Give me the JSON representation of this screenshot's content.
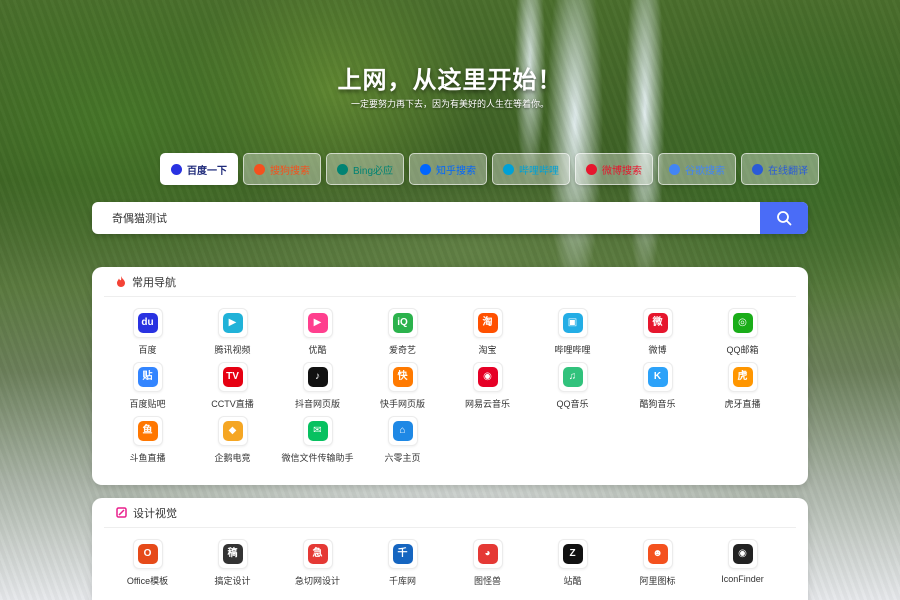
{
  "hero": {
    "title": "上网，从这里开始！",
    "subtitle": "一定要努力再下去，因为有美好的人生在等着你。"
  },
  "engines": [
    {
      "label": "百度一下",
      "icon": "baidu-icon",
      "color": "#2932e1",
      "active": true
    },
    {
      "label": "搜狗搜索",
      "icon": "sogou-icon",
      "color": "#f4511e",
      "active": false
    },
    {
      "label": "Bing必应",
      "icon": "bing-icon",
      "color": "#008373",
      "active": false
    },
    {
      "label": "知乎搜索",
      "icon": "zhihu-icon",
      "color": "#0066ff",
      "active": false
    },
    {
      "label": "哔哩哔哩",
      "icon": "bilibili-icon",
      "color": "#00a1d6",
      "active": false
    },
    {
      "label": "微博搜索",
      "icon": "weibo-icon",
      "color": "#e6162d",
      "active": false
    },
    {
      "label": "谷歌搜索",
      "icon": "google-icon",
      "color": "#4285f4",
      "active": false
    },
    {
      "label": "在线翻译",
      "icon": "translate-icon",
      "color": "#2a5bd7",
      "active": false
    }
  ],
  "search": {
    "value": "奇偶猫测试",
    "button_icon": "search-icon",
    "button_color": "#4a6cf7"
  },
  "sections": [
    {
      "title": "常用导航",
      "icon": "fire-icon",
      "icon_color": "#f44336",
      "items": [
        {
          "label": "百度",
          "icon": "baidu-icon",
          "glyph": "du",
          "color": "#2932e1"
        },
        {
          "label": "腾讯视频",
          "icon": "tencent-video-icon",
          "glyph": "▶",
          "color": "#20b2d8"
        },
        {
          "label": "优酷",
          "icon": "youku-icon",
          "glyph": "▶",
          "color": "#ff3f8e"
        },
        {
          "label": "爱奇艺",
          "icon": "iqiyi-icon",
          "glyph": "iQ",
          "color": "#2bb24c"
        },
        {
          "label": "淘宝",
          "icon": "taobao-icon",
          "glyph": "淘",
          "color": "#ff5000"
        },
        {
          "label": "哔哩哔哩",
          "icon": "bilibili-icon",
          "glyph": "▣",
          "color": "#23ade5"
        },
        {
          "label": "微博",
          "icon": "weibo-icon",
          "glyph": "微",
          "color": "#e6162d"
        },
        {
          "label": "QQ邮箱",
          "icon": "qq-mail-icon",
          "glyph": "◎",
          "color": "#1aad19"
        },
        {
          "label": "百度贴吧",
          "icon": "tieba-icon",
          "glyph": "贴",
          "color": "#3385ff"
        },
        {
          "label": "CCTV直播",
          "icon": "cctv-icon",
          "glyph": "TV",
          "color": "#e60012"
        },
        {
          "label": "抖音网页版",
          "icon": "douyin-icon",
          "glyph": "♪",
          "color": "#111111"
        },
        {
          "label": "快手网页版",
          "icon": "kuaishou-icon",
          "glyph": "快",
          "color": "#ff7a00"
        },
        {
          "label": "网易云音乐",
          "icon": "netease-music-icon",
          "glyph": "◉",
          "color": "#e60026"
        },
        {
          "label": "QQ音乐",
          "icon": "qq-music-icon",
          "glyph": "♫",
          "color": "#31c27c"
        },
        {
          "label": "酷狗音乐",
          "icon": "kugou-icon",
          "glyph": "K",
          "color": "#2ca2f9"
        },
        {
          "label": "虎牙直播",
          "icon": "huya-icon",
          "glyph": "虎",
          "color": "#ff9600"
        },
        {
          "label": "斗鱼直播",
          "icon": "douyu-icon",
          "glyph": "鱼",
          "color": "#ff7700"
        },
        {
          "label": "企鹅电竞",
          "icon": "penguin-esports-icon",
          "glyph": "◆",
          "color": "#f5a623"
        },
        {
          "label": "微信文件传输助手",
          "icon": "wechat-icon",
          "glyph": "✉",
          "color": "#07c160"
        },
        {
          "label": "六零主页",
          "icon": "home-icon",
          "glyph": "⌂",
          "color": "#1e88e5"
        }
      ]
    },
    {
      "title": "设计视觉",
      "icon": "design-icon",
      "icon_color": "#e91e8c",
      "items": [
        {
          "label": "Office模板",
          "icon": "office-icon",
          "glyph": "O",
          "color": "#e64a19"
        },
        {
          "label": "搞定设计",
          "icon": "gaoding-icon",
          "glyph": "稿",
          "color": "#333333"
        },
        {
          "label": "急切网设计",
          "icon": "jiqie-icon",
          "glyph": "急",
          "color": "#e53935"
        },
        {
          "label": "千库网",
          "icon": "qianku-icon",
          "glyph": "千",
          "color": "#1565c0"
        },
        {
          "label": "图怪兽",
          "icon": "tuguaishou-icon",
          "glyph": "◕",
          "color": "#e53935"
        },
        {
          "label": "站酷",
          "icon": "zcool-icon",
          "glyph": "Z",
          "color": "#111111"
        },
        {
          "label": "阿里图标",
          "icon": "iconfont-icon",
          "glyph": "☻",
          "color": "#f4511e"
        },
        {
          "label": "IconFinder",
          "icon": "iconfinder-icon",
          "glyph": "◉",
          "color": "#222222"
        }
      ]
    }
  ]
}
